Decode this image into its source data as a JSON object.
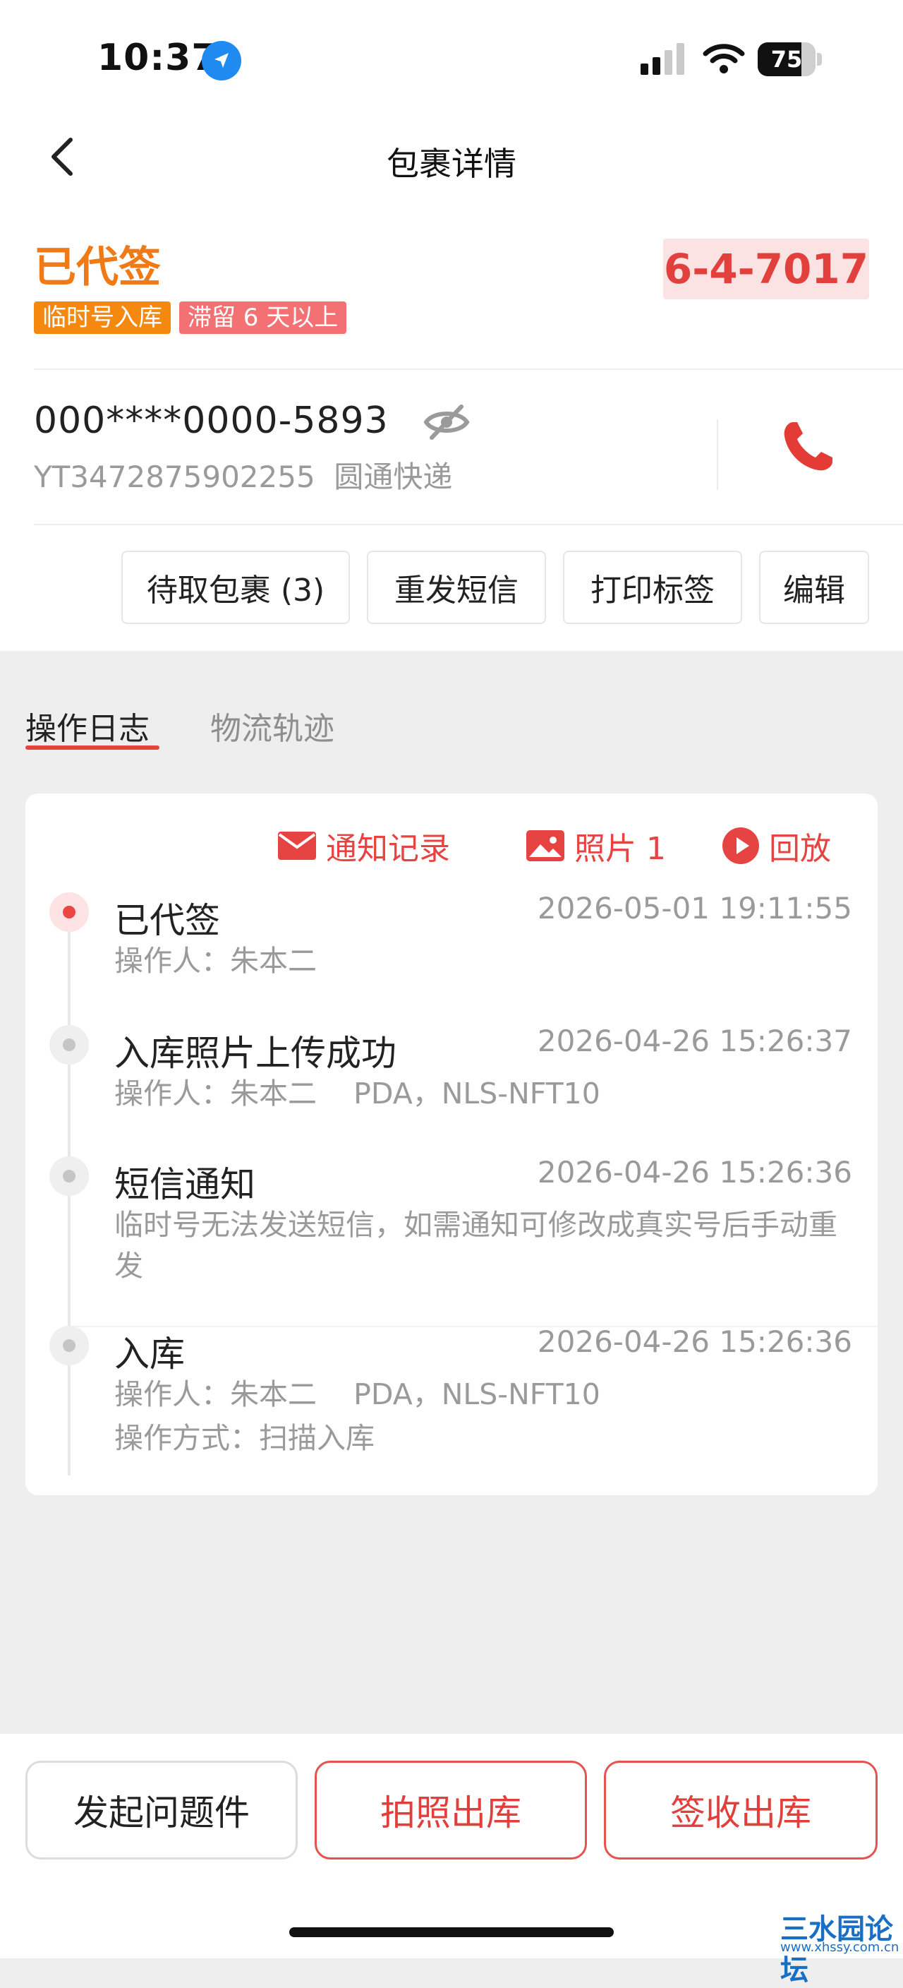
{
  "status_bar": {
    "time": "10:37",
    "battery": "75",
    "battery_level": 0.75
  },
  "nav": {
    "title": "包裹详情"
  },
  "package": {
    "status": "已代签",
    "tags": [
      "临时号入库",
      "滞留 6 天以上"
    ],
    "shelf_code": "6-4-7017",
    "phone": "000****0000-5893",
    "tracking_number": "YT3472875902255",
    "courier": "圆通快递"
  },
  "actions": [
    "待取包裹 (3)",
    "重发短信",
    "打印标签",
    "编辑"
  ],
  "tabs": {
    "active": "操作日志",
    "inactive": "物流轨迹"
  },
  "log_links": {
    "notify": "通知记录",
    "photo": "照片 1",
    "replay": "回放"
  },
  "logs": [
    {
      "title": "已代签",
      "time": "2026-05-01 19:11:55",
      "lines": [
        "操作人：朱本二"
      ]
    },
    {
      "title": "入库照片上传成功",
      "time": "2026-04-26 15:26:37",
      "lines": [
        "操作人：朱本二    PDA，NLS-NFT10"
      ]
    },
    {
      "title": "短信通知",
      "time": "2026-04-26 15:26:36",
      "lines": [
        "临时号无法发送短信，如需通知可修改成真实号后手动重发"
      ]
    },
    {
      "title": "入库",
      "time": "2026-04-26 15:26:36",
      "lines": [
        "操作人：朱本二    PDA，NLS-NFT10",
        "操作方式：扫描入库"
      ]
    }
  ],
  "bottom_buttons": {
    "issue": "发起问题件",
    "photo_out": "拍照出库",
    "sign_out": "签收出库"
  },
  "watermark": {
    "text": "三水园论坛",
    "url": "www.xhssy.com.cn"
  },
  "colors": {
    "accent_red": "#e44340",
    "status_orange": "#f07a16",
    "tag_orange": "#f5890f",
    "tag_red": "#f37073"
  },
  "icons": [
    "location-arrow-icon",
    "cell-signal-icon",
    "wifi-icon",
    "battery-icon",
    "back-chevron-icon",
    "eye-off-icon",
    "phone-icon",
    "mail-icon",
    "photo-icon",
    "play-icon"
  ]
}
